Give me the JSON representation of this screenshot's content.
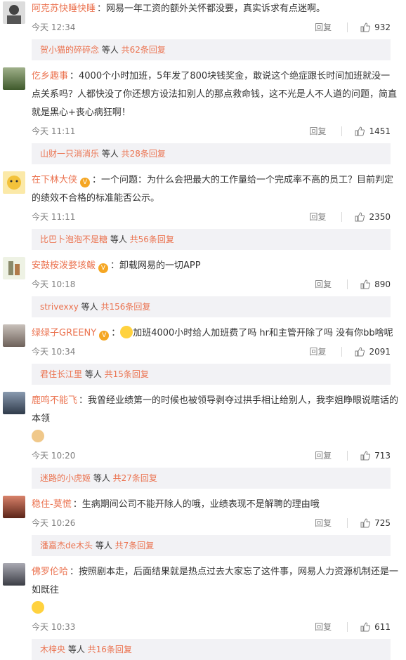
{
  "comments": [
    {
      "user": "阿克苏快睡快睡",
      "text": "：网易一年工资的额外关怀都没要，真实诉求有点迷啊。",
      "time": "今天 12:34",
      "likes": "932",
      "reply_label": "回复",
      "replies": {
        "user": "贺小猫的碎碎念",
        "etc": " 等人 ",
        "count": "共62条回复"
      }
    },
    {
      "user": "仡乡趣事",
      "text": "：4000个小时加班，5年发了800块钱奖金，敢说这个绝症跟长时间加班就没一点关系吗？人都快没了你还想方设法扣别人的那点救命钱，这不光是人不人道的问题，简直就是黑心+丧心病狂啊！",
      "time": "今天 11:11",
      "likes": "1451",
      "reply_label": "回复",
      "replies": {
        "user": "山财一只消消乐",
        "etc": " 等人 ",
        "count": "共28条回复"
      }
    },
    {
      "user": "在下林大侠",
      "text": "：一个问题：为什么会把最大的工作量给一个完成率不高的员工？目前判定的绩效不合格的标准能否公示。",
      "time": "今天 11:11",
      "likes": "2350",
      "reply_label": "回复",
      "replies": {
        "user": "比巴卜泡泡不是糖",
        "etc": " 等人 ",
        "count": "共56条回复"
      }
    },
    {
      "user": "安鼓桉泼婺垓鲅",
      "text": "：卸载网易的一切APP",
      "time": "今天 10:18",
      "likes": "890",
      "reply_label": "回复",
      "replies": {
        "user": "strivexxy",
        "etc": " 等人 ",
        "count": "共156条回复"
      }
    },
    {
      "user": "绿绿子GREENY",
      "text": "加班4000小时给人加班费了吗 hr和主管开除了吗 没有你bb啥呢",
      "time": "今天 10:34",
      "likes": "2091",
      "reply_label": "回复",
      "replies": {
        "user": "君住长江里",
        "etc": " 等人 ",
        "count": "共15条回复"
      }
    },
    {
      "user": "鹿鸣不能飞",
      "text": "：我曾经业绩第一的时候也被领导剥夺过拱手相让给别人，我李姐睁眼说瞎话的本领",
      "time": "今天 10:20",
      "likes": "713",
      "reply_label": "回复",
      "replies": {
        "user": "迷路的小虎姬",
        "etc": " 等人 ",
        "count": "共27条回复"
      }
    },
    {
      "user": "稳住-莫慌",
      "text": "：生病期间公司不能开除人的哦，业绩表现不是解聘的理由哦",
      "time": "今天 10:26",
      "likes": "725",
      "reply_label": "回复",
      "replies": {
        "user": "潘嘉杰de木头",
        "etc": " 等人 ",
        "count": "共7条回复"
      }
    },
    {
      "user": "佛罗伦哈",
      "text": "：按照剧本走，后面结果就是热点过去大家忘了这件事，网易人力资源机制还是一如既往",
      "time": "今天 10:33",
      "likes": "611",
      "reply_label": "回复",
      "replies": {
        "user": "木梓央",
        "etc": " 等人 ",
        "count": "共16条回复"
      }
    }
  ],
  "colors": {
    "username": "#eb7350",
    "reply_bg": "#f2f2f5",
    "meta": "#808080"
  }
}
